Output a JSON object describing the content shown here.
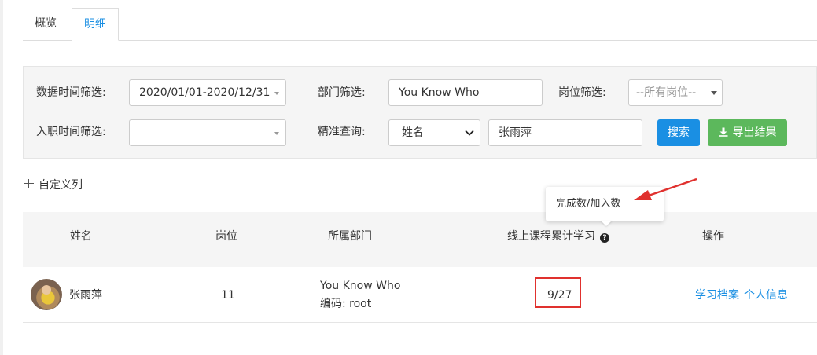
{
  "tabs": [
    {
      "label": "概览",
      "active": false
    },
    {
      "label": "明细",
      "active": true
    }
  ],
  "filters": {
    "data_time_label": "数据时间筛选:",
    "data_time_value": "2020/01/01-2020/12/31",
    "dept_label": "部门筛选:",
    "dept_value": "You Know Who",
    "position_label": "岗位筛选:",
    "position_value": "--所有岗位--",
    "entry_time_label": "入职时间筛选:",
    "entry_time_value": "",
    "exact_label": "精准查询:",
    "exact_field": "姓名",
    "exact_value": "张雨萍",
    "search_button": "搜索",
    "export_button": "导出结果"
  },
  "custom_column_label": "自定义列",
  "tooltip": "完成数/加入数",
  "table": {
    "headers": [
      "姓名",
      "岗位",
      "所属部门",
      "线上课程累计学习",
      "操作"
    ],
    "rows": [
      {
        "name": "张雨萍",
        "position": "11",
        "dept_name": "You Know Who",
        "dept_code": "编码: root",
        "course_progress": "9/27",
        "actions": [
          "学习档案",
          "个人信息"
        ]
      }
    ]
  },
  "colors": {
    "accent": "#1a8fe3",
    "export_green": "#5cb85c",
    "highlight_red": "#e0312e"
  },
  "icons": [
    "plus-icon",
    "question-icon",
    "download-icon",
    "chevron-down-icon"
  ]
}
